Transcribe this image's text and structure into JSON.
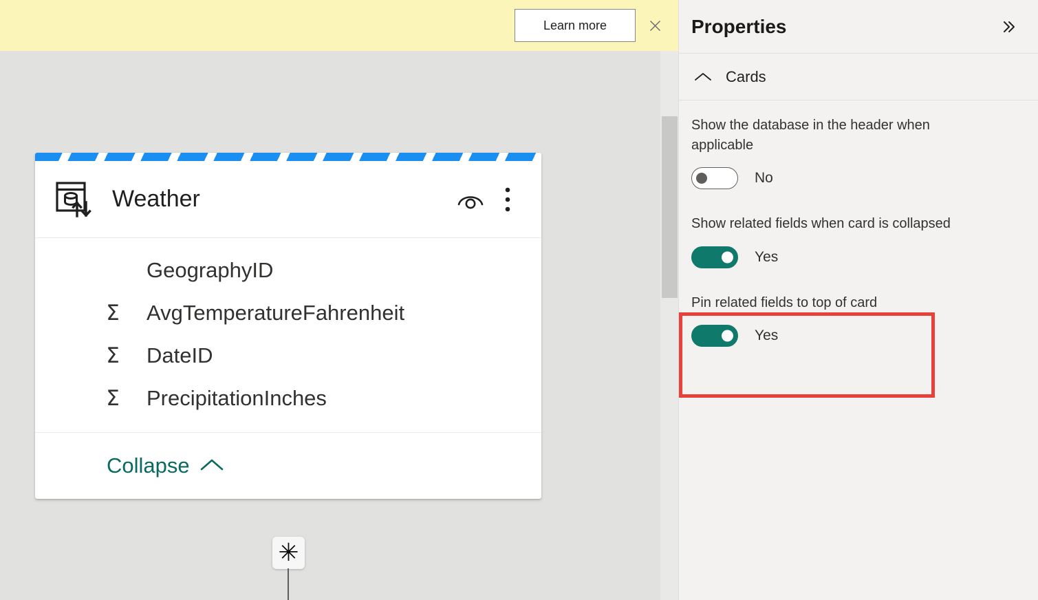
{
  "banner": {
    "learn_more_label": "Learn more",
    "close_icon": "close-icon",
    "background_color": "#fcf5ba"
  },
  "canvas": {
    "background_color": "#e1e1df",
    "table_card": {
      "header_icon": "table-directquery-icon",
      "title": "Weather",
      "preview_icon": "preview-eye-icon",
      "more_icon": "more-vertical-icon",
      "stripe_color": "#1b8ef2",
      "fields": [
        {
          "name": "GeographyID",
          "aggregate_icon": ""
        },
        {
          "name": "AvgTemperatureFahrenheit",
          "aggregate_icon": "Σ"
        },
        {
          "name": "DateID",
          "aggregate_icon": "Σ"
        },
        {
          "name": "PrecipitationInches",
          "aggregate_icon": "Σ"
        }
      ],
      "collapse_label": "Collapse",
      "collapse_icon": "chevron-up-icon"
    },
    "relationship": {
      "cardinality_symbol": "✳",
      "cardinality_name": "many-cardinality-badge"
    }
  },
  "properties_panel": {
    "title": "Properties",
    "collapse_icon": "chevron-double-right-icon",
    "sections": [
      {
        "label": "Cards",
        "expanded": true,
        "chevron_icon": "chevron-up-icon",
        "properties": [
          {
            "label": "Show the database in the header when applicable",
            "value": "No",
            "state": "off",
            "highlighted": false
          },
          {
            "label": "Show related fields when card is collapsed",
            "value": "Yes",
            "state": "on",
            "highlighted": false
          },
          {
            "label": "Pin related fields to top of card",
            "value": "Yes",
            "state": "on",
            "highlighted": true
          }
        ]
      }
    ],
    "accent_color": "#0f7a6b",
    "highlight_color": "#e8403a",
    "background_color": "#f3f2f1"
  }
}
